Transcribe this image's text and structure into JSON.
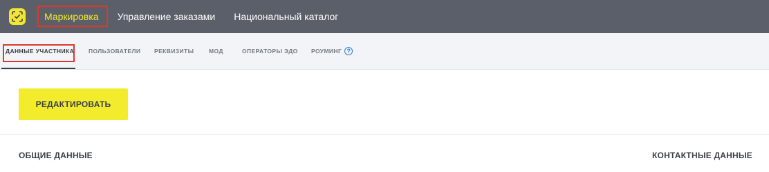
{
  "header": {
    "logo_icon": "marking-scan-icon",
    "nav": [
      {
        "label": "Маркировка",
        "active": true
      },
      {
        "label": "Управление заказами",
        "active": false
      },
      {
        "label": "Национальный каталог",
        "active": false
      }
    ]
  },
  "tabs": [
    {
      "label": "ДАННЫЕ УЧАСТНИКА",
      "active": true
    },
    {
      "label": "ПОЛЬЗОВАТЕЛИ",
      "active": false
    },
    {
      "label": "РЕКВИЗИТЫ",
      "active": false
    },
    {
      "label": "МОД",
      "active": false
    },
    {
      "label": "ОПЕРАТОРЫ ЭДО",
      "active": false
    },
    {
      "label": "РОУМИНГ",
      "active": false,
      "help_icon": "?"
    }
  ],
  "actions": {
    "edit_label": "РЕДАКТИРОВАТЬ"
  },
  "sections": {
    "general": "ОБЩИЕ ДАННЫЕ",
    "contacts": "КОНТАКТНЫЕ ДАННЫЕ"
  },
  "colors": {
    "topbar": "#5a5f69",
    "accent_yellow": "#f2e634",
    "highlight_red": "#d93a2b",
    "help_blue": "#2f7bdc"
  }
}
